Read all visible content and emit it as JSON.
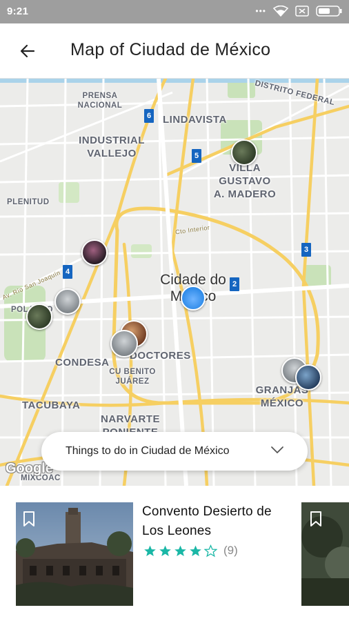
{
  "status_bar": {
    "time": "9:21"
  },
  "app_bar": {
    "title": "Map of Ciudad de México"
  },
  "map": {
    "labels": {
      "prensa_nacional": "PRENSA\nNACIONAL",
      "distrito_federal": "DISTRITO FEDERAL",
      "lindavista": "LINDAVISTA",
      "industrial_vallejo": "INDUSTRIAL\nVALLEJO",
      "villa_gustavo": "VILLA GUSTAVO\nA. MADERO",
      "plenitud": "PLENITUD",
      "circuito": "Cto Interior",
      "rio_san_joaquin": "Av. Río San Joaquín",
      "polanco": "POLANCO",
      "cidade": "Cidade do\nMéxico",
      "doctores": "DOCTORES",
      "condesa": "CONDESA",
      "cu_benito": "CU BENITO\nJUÁREZ",
      "tacubaya": "TACUBAYA",
      "narvarte": "NARVARTE\nPONIENTE",
      "granjas": "GRANJAS\nMÉXICO",
      "mixcoac": "MIXCOAC"
    },
    "metro_stations": [
      "6",
      "5",
      "4",
      "3",
      "2"
    ],
    "google_logo": "Google",
    "things_pill_label": "Things to do in Ciudad de México"
  },
  "card": {
    "title": "Convento Desierto de Los Leones",
    "rating": 4,
    "max_rating": 5,
    "review_count": "(9)"
  },
  "colors": {
    "accent_star": "#1ab7a6",
    "metro_blue": "#1565c0",
    "location_dot": "#2d8ae8"
  }
}
